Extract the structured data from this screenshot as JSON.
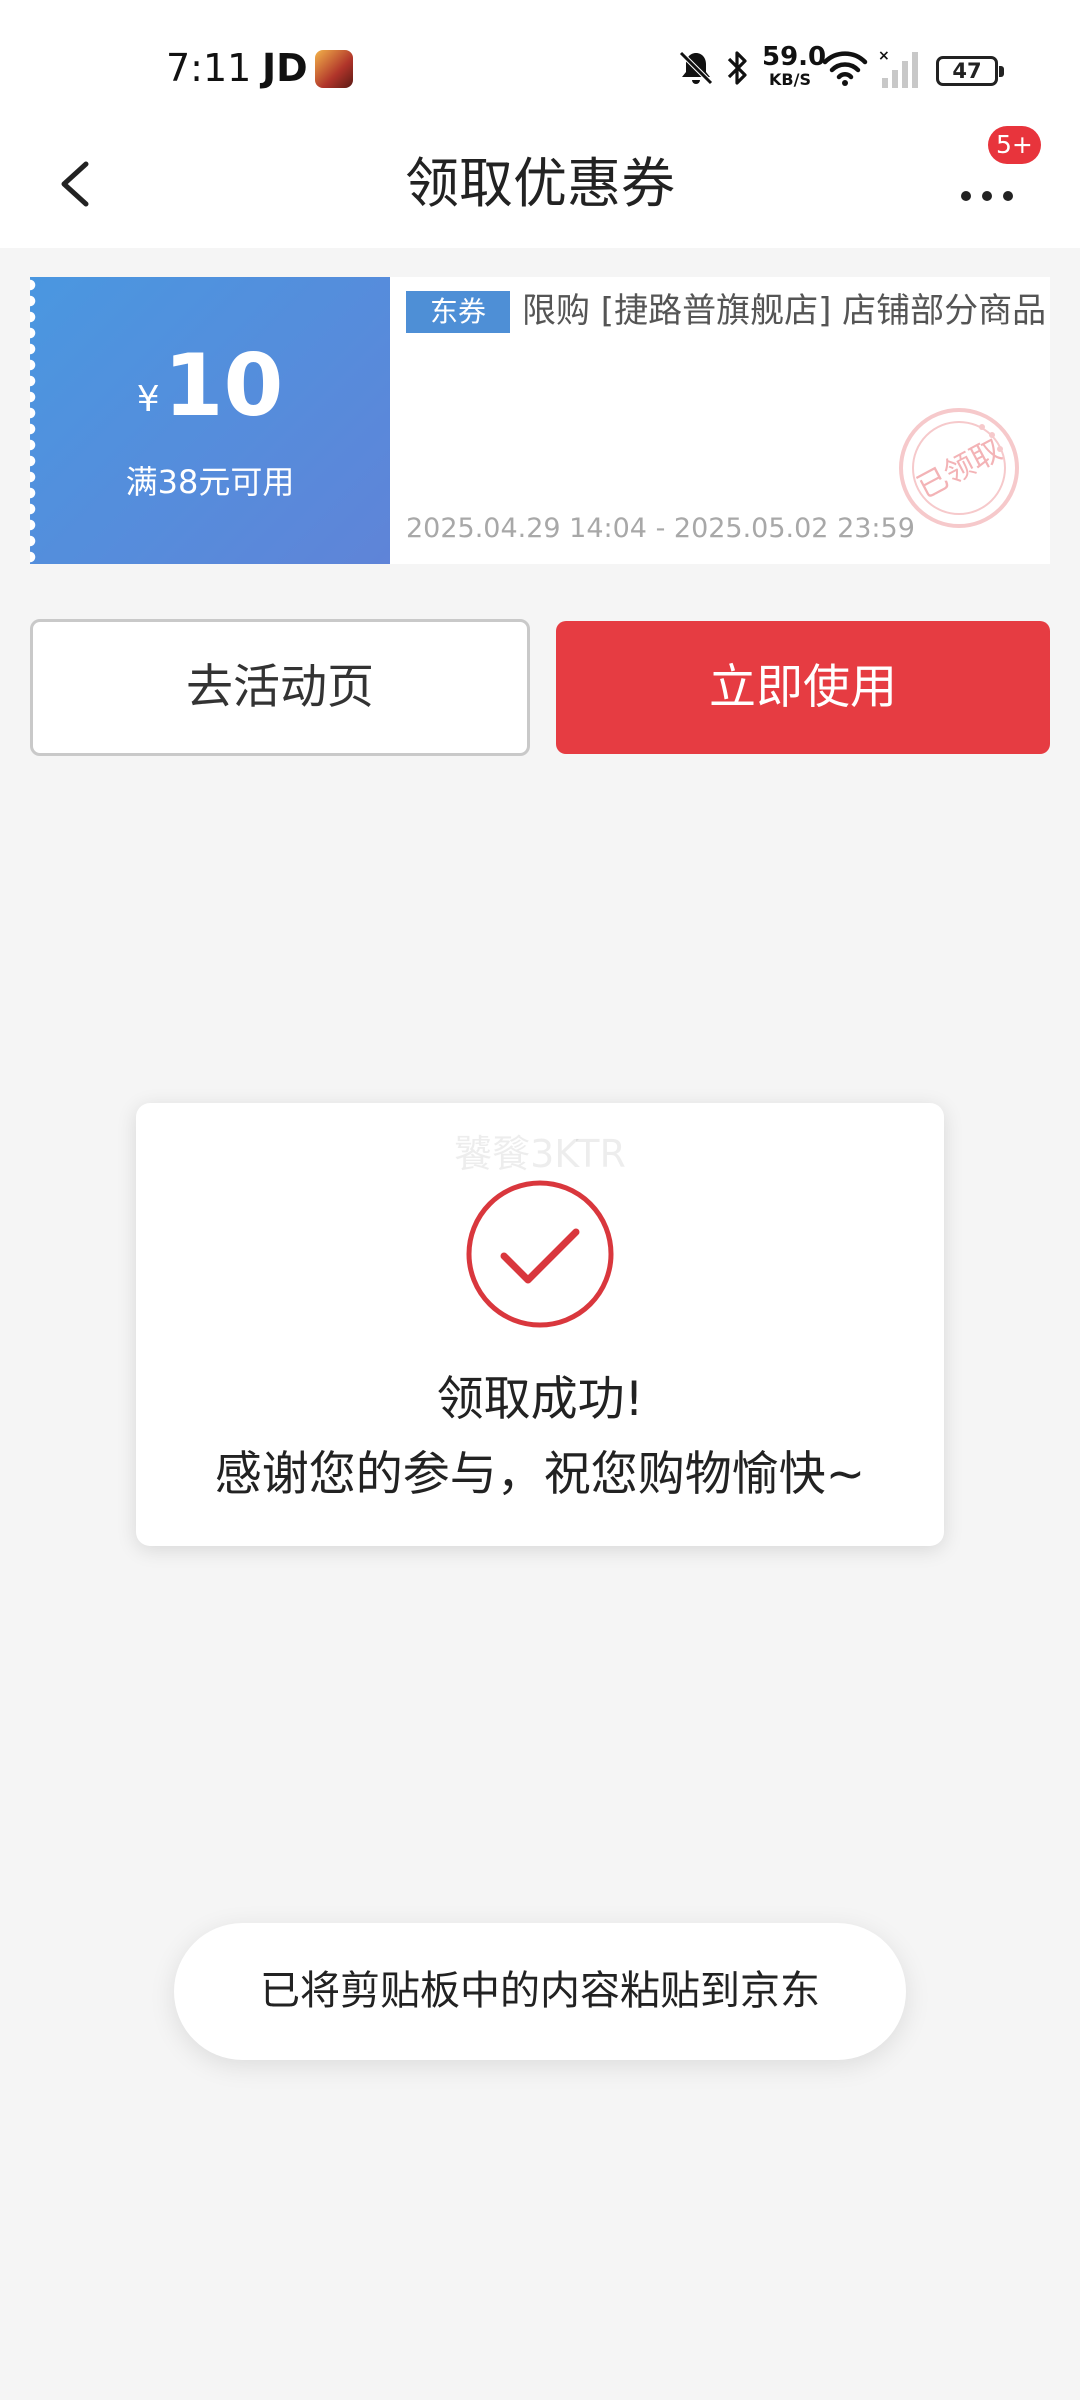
{
  "status_bar": {
    "time": "7:11",
    "carrier": "JD",
    "net_speed_value": "59.0",
    "net_speed_unit": "KB/S",
    "battery": "47",
    "icons": [
      "app-avatar-icon",
      "mute-bell-icon",
      "bluetooth-icon",
      "wifi-icon",
      "signal-icon"
    ]
  },
  "nav": {
    "title": "领取优惠券",
    "badge": "5+",
    "icons": [
      "back-arrow-icon",
      "more-dots-icon"
    ]
  },
  "coupon": {
    "currency": "¥",
    "amount": "10",
    "condition": "满38元可用",
    "tag": "东券",
    "description": "限购 [捷路普旗舰店] 店铺部分商品",
    "validity": "2025.04.29 14:04 - 2025.05.02 23:59",
    "stamp": "已领取",
    "colors": {
      "left_start": "#4a97e0",
      "left_end": "#5f84d8",
      "tag": "#4e8fd6"
    }
  },
  "actions": {
    "activity_label": "去活动页",
    "use_label": "立即使用",
    "use_color": "#e63c42"
  },
  "dialog": {
    "watermark": "饕餮3KTR",
    "title": "领取成功!",
    "message": "感谢您的参与，祝您购物愉快~",
    "icon": "check-circle-icon",
    "accent": "#d9373d"
  },
  "toast": {
    "message": "已将剪贴板中的内容粘贴到京东"
  }
}
